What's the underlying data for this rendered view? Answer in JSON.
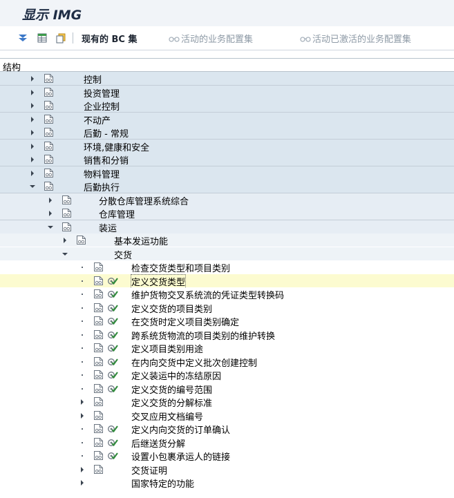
{
  "header": {
    "title": "显示 IMG"
  },
  "toolbar": {
    "existing_bc": "现有的 BC 集",
    "active_bc": "活动的业务配置集",
    "activated_bc": "活动已激活的业务配置集"
  },
  "structure": {
    "heading": "结构"
  },
  "tree": [
    {
      "level": 1,
      "label": "控制",
      "state": "collapsed",
      "exec": false
    },
    {
      "level": 1,
      "label": "投资管理",
      "state": "collapsed",
      "exec": false
    },
    {
      "level": 1,
      "label": "企业控制",
      "state": "collapsed",
      "exec": false
    },
    {
      "level": 1,
      "label": "不动产",
      "state": "collapsed",
      "exec": false
    },
    {
      "level": 1,
      "label": "后勤 - 常规",
      "state": "collapsed",
      "exec": false
    },
    {
      "level": 1,
      "label": "环境,健康和安全",
      "state": "collapsed",
      "exec": false
    },
    {
      "level": 1,
      "label": "销售和分销",
      "state": "collapsed",
      "exec": false
    },
    {
      "level": 1,
      "label": "物料管理",
      "state": "collapsed",
      "exec": false
    },
    {
      "level": 1,
      "label": "后勤执行",
      "state": "expanded",
      "exec": false
    },
    {
      "level": 2,
      "label": "分散仓库管理系统综合",
      "state": "collapsed",
      "exec": false
    },
    {
      "level": 2,
      "label": "仓库管理",
      "state": "collapsed",
      "exec": false
    },
    {
      "level": 2,
      "label": "装运",
      "state": "expanded",
      "exec": false
    },
    {
      "level": 3,
      "label": "基本发运功能",
      "state": "collapsed",
      "exec": false
    },
    {
      "level": 3,
      "label": "交货",
      "state": "expanded",
      "exec": false,
      "noicon": true
    },
    {
      "level": 4,
      "label": "检查交货类型和项目类别",
      "state": "leaf",
      "exec": false
    },
    {
      "level": 4,
      "label": "定义交货类型",
      "state": "leaf",
      "exec": true,
      "selected": true
    },
    {
      "level": 4,
      "label": "维护货物交叉系统流的凭证类型转换码",
      "state": "leaf",
      "exec": true
    },
    {
      "level": 4,
      "label": "定义交货的项目类别",
      "state": "leaf",
      "exec": true
    },
    {
      "level": 4,
      "label": "在交货时定义项目类别确定",
      "state": "leaf",
      "exec": true
    },
    {
      "level": 4,
      "label": "跨系统货物流的项目类别的维护转换",
      "state": "leaf",
      "exec": true
    },
    {
      "level": 4,
      "label": "定义项目类别用途",
      "state": "leaf",
      "exec": true
    },
    {
      "level": 4,
      "label": "在内向交货中定义批次创建控制",
      "state": "leaf",
      "exec": true
    },
    {
      "level": 4,
      "label": "定义装运中的冻结原因",
      "state": "leaf",
      "exec": true
    },
    {
      "level": 4,
      "label": "定义交货的编号范围",
      "state": "leaf",
      "exec": true
    },
    {
      "level": 4,
      "label": "定义交货的分解标准",
      "state": "collapsed",
      "exec": false
    },
    {
      "level": 4,
      "label": "交叉应用文档编号",
      "state": "collapsed",
      "exec": false
    },
    {
      "level": 4,
      "label": "定义内向交货的订单确认",
      "state": "leaf",
      "exec": true
    },
    {
      "level": 4,
      "label": "后继送货分解",
      "state": "leaf",
      "exec": true
    },
    {
      "level": 4,
      "label": "设置小包裹承运人的链接",
      "state": "leaf",
      "exec": true
    },
    {
      "level": 4,
      "label": "交货证明",
      "state": "collapsed",
      "exec": false
    },
    {
      "level": 4,
      "label": "国家特定的功能",
      "state": "collapsed",
      "exec": false,
      "noicon": true
    }
  ],
  "colors": {
    "titlebar_bg": "#f1f4f8",
    "title_text": "#1f2d45",
    "level1_bg": "#dbe6ef",
    "level2_bg": "#e6edf4",
    "selected_bg": "#fcfbd0",
    "exec_icon": "#2f8a3a"
  }
}
